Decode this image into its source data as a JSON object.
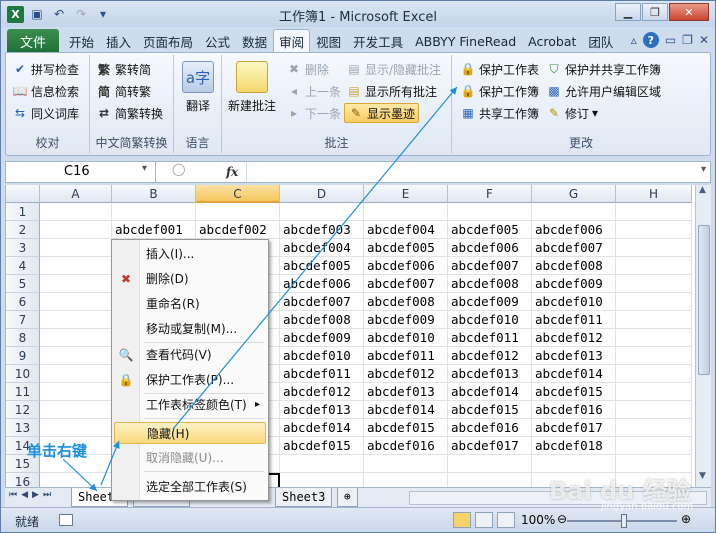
{
  "title": "工作簿1 - Microsoft Excel",
  "file_tab": "文件",
  "tabs": [
    "开始",
    "插入",
    "页面布局",
    "公式",
    "数据",
    "审阅",
    "视图",
    "开发工具",
    "ABBYY FineRead",
    "Acrobat",
    "团队"
  ],
  "active_tab": "审阅",
  "ribbon": {
    "proof": {
      "label": "校对",
      "items": [
        "拼写检查",
        "信息检索",
        "同义词库"
      ]
    },
    "chinese": {
      "label": "中文简繁转换",
      "items": [
        "繁转简",
        "简转繁",
        "简繁转换"
      ]
    },
    "language": {
      "label": "语言",
      "translate": "翻译"
    },
    "comments": {
      "label": "批注",
      "new": "新建批注",
      "delete": "删除",
      "prev": "上一条",
      "next": "下一条",
      "showhide": "显示/隐藏批注",
      "showall": "显示所有批注",
      "showink": "显示墨迹"
    },
    "changes": {
      "label": "更改",
      "protect_sheet": "保护工作表",
      "protect_book": "保护工作簿",
      "share_book": "共享工作簿",
      "protect_share": "保护并共享工作簿",
      "allow_edit": "允许用户编辑区域",
      "track": "修订"
    }
  },
  "name_box": "C16",
  "fx": "fx",
  "columns": [
    "A",
    "B",
    "C",
    "D",
    "E",
    "F",
    "G",
    "H"
  ],
  "selected_column": "C",
  "rows": [
    "1",
    "2",
    "3",
    "4",
    "5",
    "6",
    "7",
    "8",
    "9",
    "10",
    "11",
    "12",
    "13",
    "14",
    "15",
    "16"
  ],
  "grid": {
    "B": [
      "abcdef001"
    ],
    "C": [
      "abcdef002"
    ],
    "D": [
      "abcdef003",
      "abcdef004",
      "abcdef005",
      "abcdef006",
      "abcdef007",
      "abcdef008",
      "abcdef009",
      "abcdef010",
      "abcdef011",
      "abcdef012",
      "abcdef013",
      "abcdef014",
      "abcdef015"
    ],
    "E": [
      "abcdef004",
      "abcdef005",
      "abcdef006",
      "abcdef007",
      "abcdef008",
      "abcdef009",
      "abcdef010",
      "abcdef011",
      "abcdef012",
      "abcdef013",
      "abcdef014",
      "abcdef015",
      "abcdef016"
    ],
    "F": [
      "abcdef005",
      "abcdef006",
      "abcdef007",
      "abcdef008",
      "abcdef009",
      "abcdef010",
      "abcdef011",
      "abcdef012",
      "abcdef013",
      "abcdef014",
      "abcdef015",
      "abcdef016",
      "abcdef017"
    ],
    "G": [
      "abcdef006",
      "abcdef007",
      "abcdef008",
      "abcdef009",
      "abcdef010",
      "abcdef011",
      "abcdef012",
      "abcdef013",
      "abcdef014",
      "abcdef015",
      "abcdef016",
      "abcdef017",
      "abcdef018"
    ]
  },
  "context_menu": [
    {
      "label": "插入(I)...",
      "icon": "none",
      "disabled": false
    },
    {
      "label": "删除(D)",
      "icon": "delete-sheet-icon",
      "disabled": false
    },
    {
      "label": "重命名(R)",
      "icon": "none",
      "disabled": false
    },
    {
      "label": "移动或复制(M)...",
      "icon": "none",
      "disabled": false
    },
    {
      "label": "查看代码(V)",
      "icon": "view-code-icon",
      "disabled": false
    },
    {
      "label": "保护工作表(P)...",
      "icon": "lock-icon",
      "disabled": false
    },
    {
      "label": "工作表标签颜色(T)",
      "icon": "none",
      "disabled": false
    },
    {
      "label": "隐藏(H)",
      "icon": "none",
      "disabled": false
    },
    {
      "label": "取消隐藏(U)...",
      "icon": "none",
      "disabled": true
    },
    {
      "label": "选定全部工作表(S)",
      "icon": "none",
      "disabled": false
    }
  ],
  "sheet_tabs": [
    "Sheet1",
    "Sheet2",
    "Sheet3"
  ],
  "status": {
    "ready": "就绪",
    "zoom": "100%"
  },
  "annotation": "单击右键",
  "watermark": "Bai du 经验",
  "watermark_sub": "jingyan.baidu.com",
  "colors": {
    "accent": "#1e7a3c",
    "highlight": "#f7cd62",
    "arrow": "#1d8fe0"
  }
}
